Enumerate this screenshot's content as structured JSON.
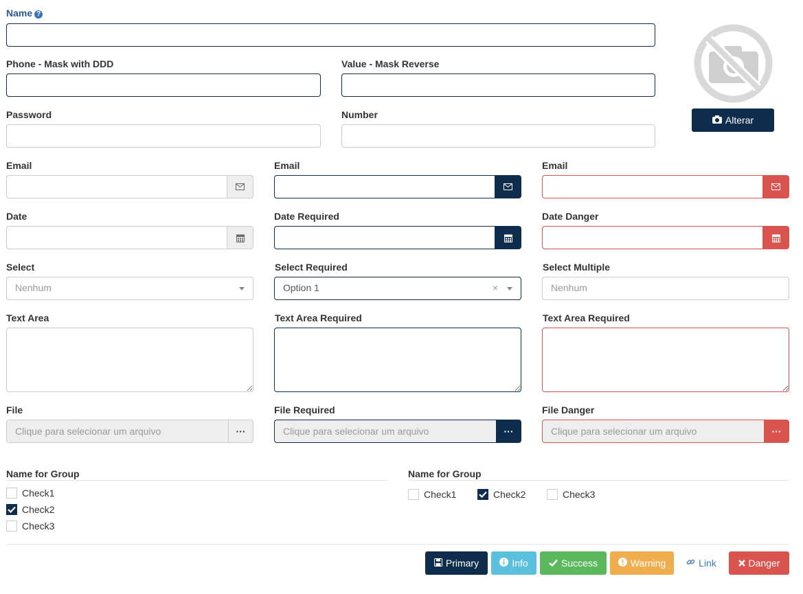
{
  "form": {
    "name": {
      "label": "Name",
      "help_icon": "question-circle-icon",
      "value": ""
    },
    "phone": {
      "label": "Phone - Mask with DDD",
      "value": ""
    },
    "value_reverse": {
      "label": "Value - Mask Reverse",
      "value": ""
    },
    "password": {
      "label": "Password",
      "value": ""
    },
    "number": {
      "label": "Number",
      "value": ""
    },
    "email_default": {
      "label": "Email",
      "icon": "envelope-icon",
      "value": ""
    },
    "email_required": {
      "label": "Email",
      "icon": "envelope-icon",
      "value": ""
    },
    "email_danger": {
      "label": "Email",
      "icon": "envelope-icon",
      "value": ""
    },
    "date_default": {
      "label": "Date",
      "icon": "calendar-icon",
      "value": ""
    },
    "date_required": {
      "label": "Date Required",
      "icon": "calendar-icon",
      "value": ""
    },
    "date_danger": {
      "label": "Date Danger",
      "icon": "calendar-icon",
      "value": ""
    },
    "select_default": {
      "label": "Select",
      "value": "Nenhum"
    },
    "select_required": {
      "label": "Select Required",
      "value": "Option 1",
      "clear_glyph": "×"
    },
    "select_multiple": {
      "label": "Select Multiple",
      "value": "Nenhum"
    },
    "textarea_default": {
      "label": "Text Area",
      "value": ""
    },
    "textarea_required": {
      "label": "Text Area Required",
      "value": ""
    },
    "textarea_danger": {
      "label": "Text Area Required",
      "value": ""
    },
    "file_default": {
      "label": "File",
      "placeholder": "Clique para selecionar um arquivo",
      "button": "···"
    },
    "file_required": {
      "label": "File Required",
      "placeholder": "Clique para selecionar um arquivo",
      "button": "···"
    },
    "file_danger": {
      "label": "File Danger",
      "placeholder": "Clique para selecionar um arquivo",
      "button": "···"
    }
  },
  "photo": {
    "placeholder_icon": "no-camera-icon",
    "button_label": "Alterar",
    "button_icon": "camera-icon"
  },
  "group_vertical": {
    "label": "Name for Group",
    "items": [
      {
        "label": "Check1",
        "checked": false
      },
      {
        "label": "Check2",
        "checked": true
      },
      {
        "label": "Check3",
        "checked": false
      }
    ]
  },
  "group_inline": {
    "label": "Name for Group",
    "items": [
      {
        "label": "Check1",
        "checked": false
      },
      {
        "label": "Check2",
        "checked": true
      },
      {
        "label": "Check3",
        "checked": false
      }
    ]
  },
  "buttons": {
    "primary": {
      "label": "Primary",
      "icon": "floppy-disk-icon"
    },
    "info": {
      "label": "Info",
      "icon": "info-circle-icon"
    },
    "success": {
      "label": "Success",
      "icon": "check-icon"
    },
    "warning": {
      "label": "Warning",
      "icon": "exclamation-circle-icon"
    },
    "link": {
      "label": "Link",
      "icon": "link-icon"
    },
    "danger": {
      "label": "Danger",
      "icon": "times-icon"
    }
  },
  "colors": {
    "primary": "#0e2d4d",
    "info": "#5bc0de",
    "success": "#5cb85c",
    "warning": "#f0ad4e",
    "danger": "#d9534f",
    "link": "#3a78b5"
  }
}
